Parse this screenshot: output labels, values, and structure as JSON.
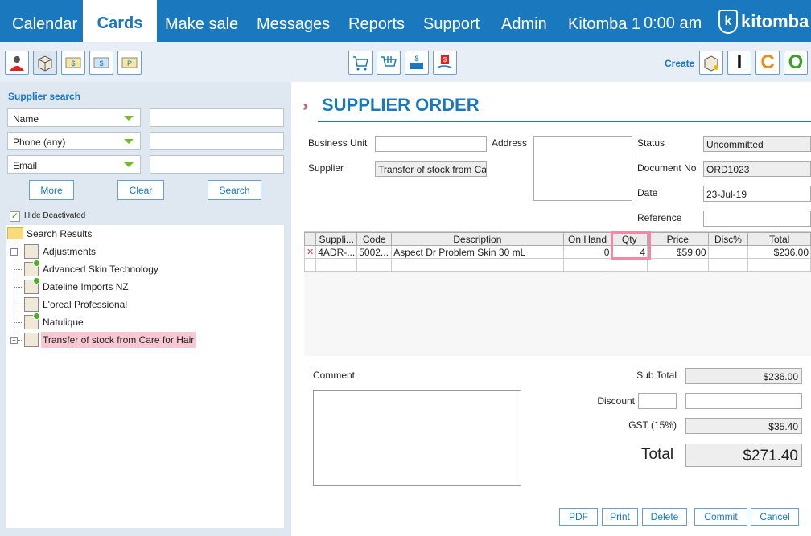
{
  "nav": {
    "tabs": [
      "Calendar",
      "Cards",
      "Make sale",
      "Messages",
      "Reports",
      "Support",
      "Admin",
      "Kitomba 1"
    ],
    "active_tab": "Cards",
    "clock": "0:00 am",
    "logo_text": "kitomba",
    "logo_mark": "k"
  },
  "toolbar": {
    "create_label": "Create",
    "create_letters": [
      "I",
      "C",
      "O"
    ]
  },
  "supplier_search": {
    "title": "Supplier search",
    "field1": "Name",
    "field2": "Phone (any)",
    "field3": "Email",
    "more": "More",
    "clear": "Clear",
    "search": "Search",
    "hide_deactivated": "Hide Deactivated",
    "results_root": "Search Results",
    "results": [
      "Adjustments",
      "Advanced Skin Technology",
      "Dateline Imports NZ",
      "L'oreal Professional",
      "Natulique",
      "Transfer of stock from Care for Hair"
    ]
  },
  "order": {
    "title": "SUPPLIER ORDER",
    "business_unit_label": "Business Unit",
    "business_unit_value": "",
    "supplier_label": "Supplier",
    "supplier_value": "Transfer of stock from Care for Hair",
    "address_label": "Address",
    "status_label": "Status",
    "status_value": "Uncommitted",
    "docno_label": "Document No",
    "docno_value": "ORD1023",
    "date_label": "Date",
    "date_value": "23-Jul-19",
    "reference_label": "Reference",
    "reference_value": ""
  },
  "grid": {
    "headers": [
      "Suppli...",
      "Code",
      "Description",
      "On Hand",
      "Qty",
      "Price",
      "Disc%",
      "Total"
    ],
    "rows": [
      {
        "supplier_code": "4ADR-...",
        "code": "5002...",
        "description": "Aspect Dr Problem Skin 30 mL",
        "on_hand": "0",
        "qty": "4",
        "price": "$59.00",
        "disc": "",
        "total": "$236.00"
      }
    ]
  },
  "totals": {
    "comment_label": "Comment",
    "subtotal_label": "Sub Total",
    "subtotal_value": "$236.00",
    "discount_label": "Discount",
    "gst_label": "GST (15%)",
    "gst_value": "$35.40",
    "total_label": "Total",
    "total_value": "$271.40"
  },
  "actions": {
    "pdf": "PDF",
    "print": "Print",
    "delete": "Delete",
    "commit": "Commit",
    "cancel": "Cancel"
  },
  "colors": {
    "brand_blue": "#1a78be",
    "accent_green": "#6fbd2b",
    "highlight_pink": "#f08aa0"
  }
}
